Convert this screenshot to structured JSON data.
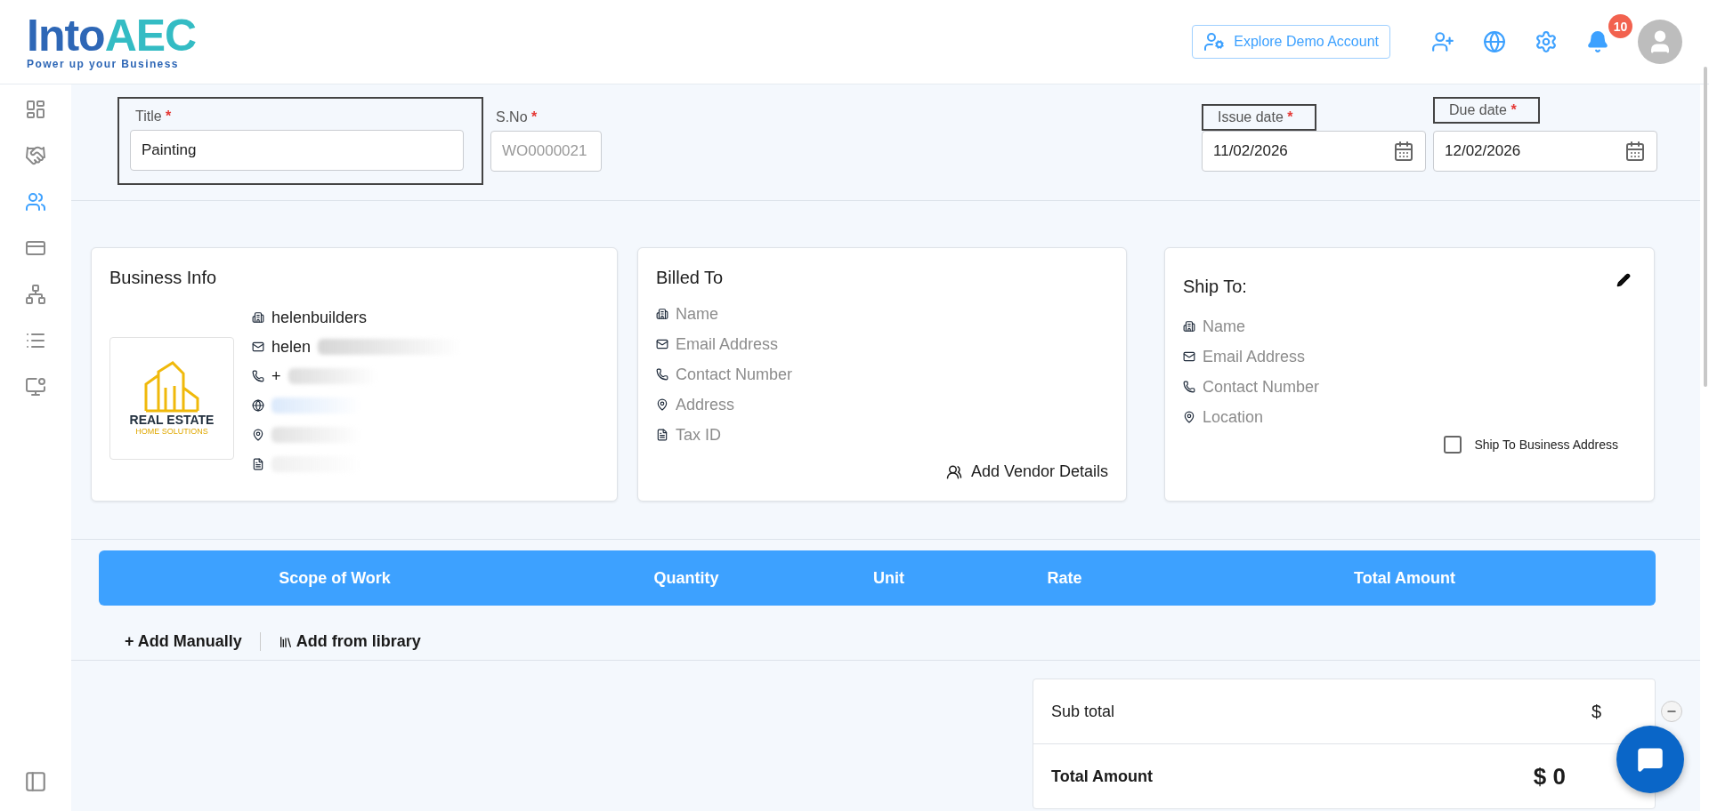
{
  "header": {
    "logo": {
      "part1": "Into",
      "part2": "AEC",
      "tagline": "Power up your Business"
    },
    "demo_button": "Explore Demo Account",
    "notification_count": "10"
  },
  "sidebar": {
    "items": [
      {
        "kind": "dashboard",
        "selected": false
      },
      {
        "kind": "handshake",
        "selected": false
      },
      {
        "kind": "team",
        "selected": true
      },
      {
        "kind": "billing",
        "selected": false
      },
      {
        "kind": "network",
        "selected": false
      },
      {
        "kind": "list",
        "selected": false
      },
      {
        "kind": "monitor",
        "selected": false
      }
    ]
  },
  "form": {
    "title": {
      "label": "Title",
      "required_mark": "*",
      "value": "Painting"
    },
    "sno": {
      "label": "S.No",
      "required_mark": "*",
      "placeholder": "WO0000021"
    },
    "issue_date": {
      "label": "Issue date",
      "required_mark": "*",
      "value": "11/02/2026"
    },
    "due_date": {
      "label": "Due date",
      "required_mark": "*",
      "value": "12/02/2026"
    }
  },
  "business_info": {
    "title": "Business Info",
    "logo": {
      "line1": "REAL ESTATE",
      "line2": "HOME SOLUTIONS"
    },
    "details": [
      {
        "kind": "building",
        "text": "helenbuilders"
      },
      {
        "kind": "mail",
        "text": "helen",
        "redacted": true
      },
      {
        "kind": "phone",
        "text": "+",
        "redacted": true
      },
      {
        "kind": "web",
        "redacted": true
      },
      {
        "kind": "pin",
        "redacted": true
      },
      {
        "kind": "tax",
        "redacted": true
      }
    ]
  },
  "billed_to": {
    "title": "Billed To",
    "fields": [
      {
        "kind": "building",
        "text": "Name"
      },
      {
        "kind": "mail",
        "text": "Email Address"
      },
      {
        "kind": "phone",
        "text": "Contact Number"
      },
      {
        "kind": "pin",
        "text": "Address"
      },
      {
        "kind": "tax",
        "text": "Tax ID"
      }
    ],
    "action": "Add Vendor Details"
  },
  "ship_to": {
    "title": "Ship To:",
    "fields": [
      {
        "kind": "building",
        "text": "Name"
      },
      {
        "kind": "mail",
        "text": "Email Address"
      },
      {
        "kind": "phone",
        "text": "Contact Number"
      },
      {
        "kind": "pin",
        "text": "Location"
      }
    ],
    "checkbox": {
      "label": "Ship To Business Address",
      "checked": false
    }
  },
  "table": {
    "columns": [
      "Scope of Work",
      "Quantity",
      "Unit",
      "Rate",
      "Total Amount"
    ]
  },
  "actions": [
    "+ Add Manually",
    "Add from library"
  ],
  "totals": [
    {
      "kind": "normal",
      "label": "Sub total",
      "value": "$"
    },
    {
      "kind": "grand",
      "label": "Total Amount",
      "value": "$ 0"
    }
  ]
}
